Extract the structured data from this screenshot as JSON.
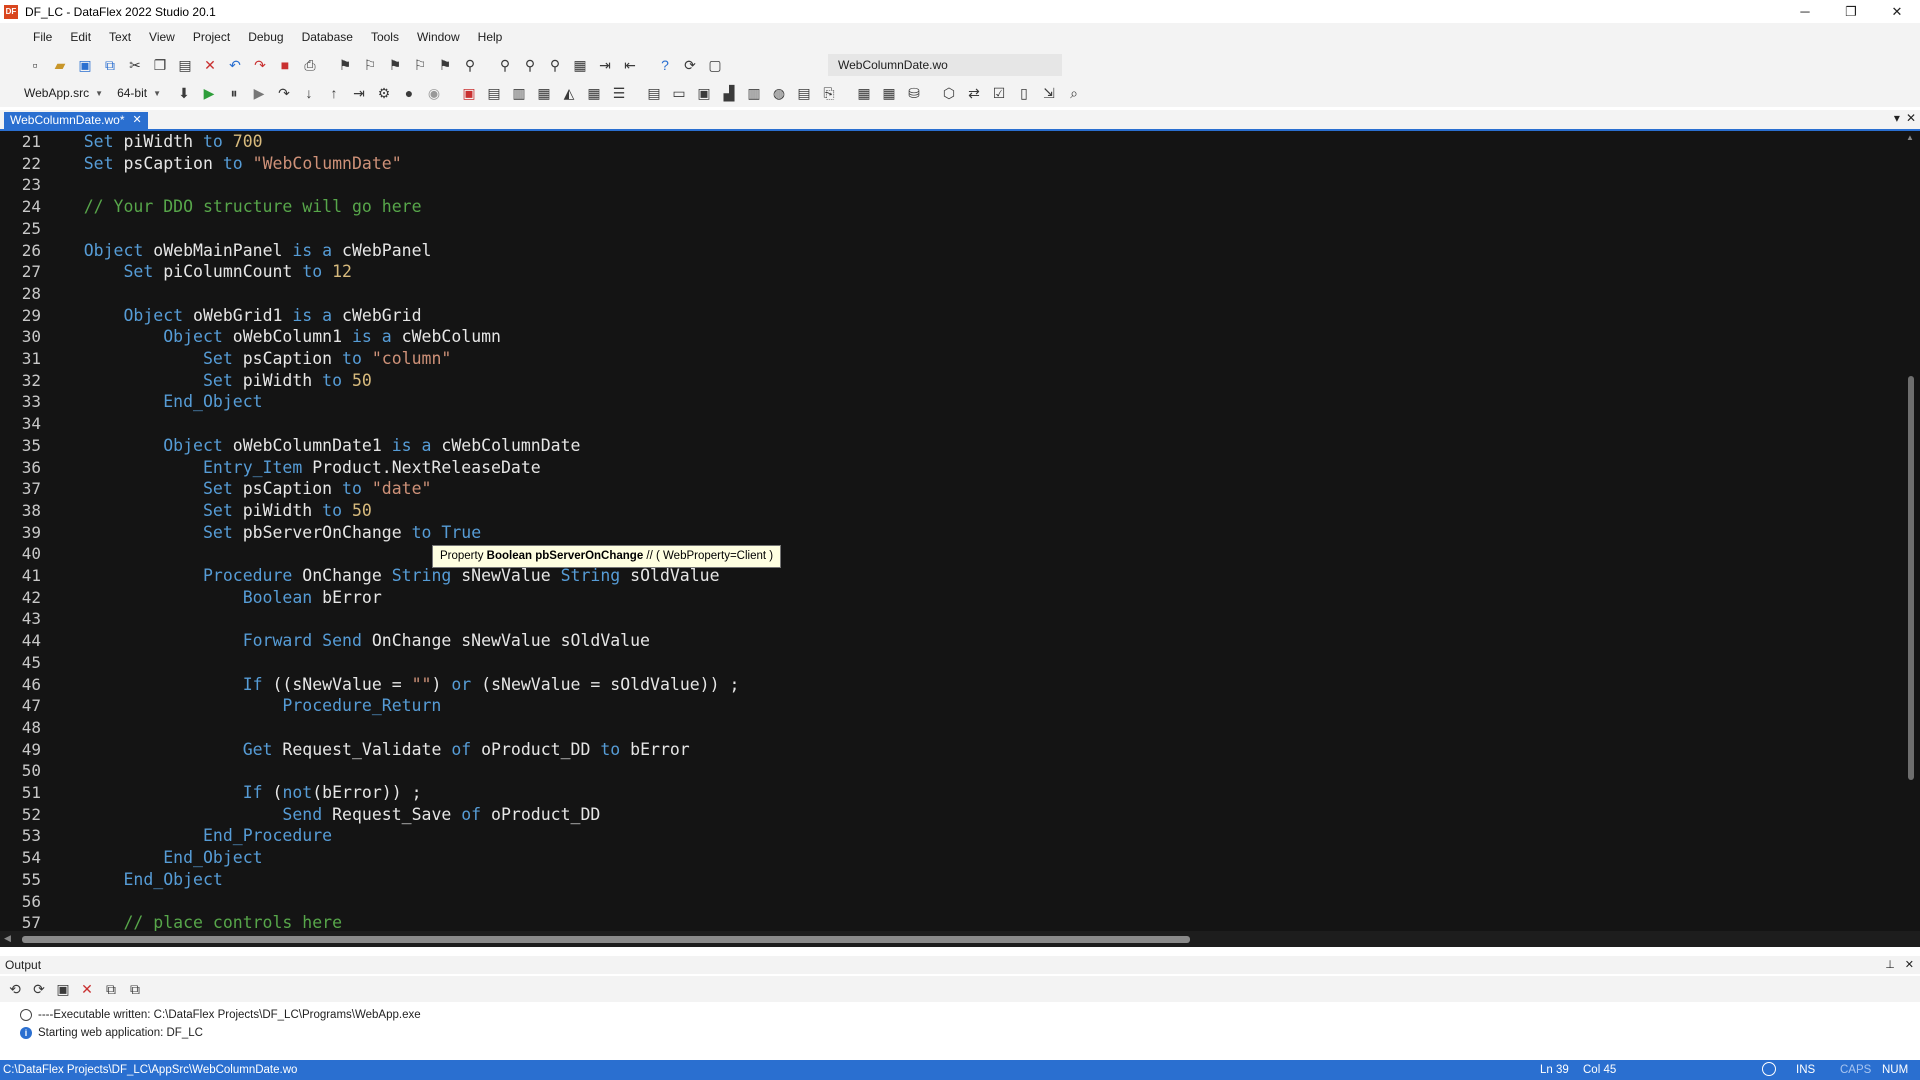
{
  "window": {
    "title": "DF_LC - DataFlex 2022 Studio 20.1",
    "app_icon": "DF",
    "controls": {
      "minimize": "─",
      "maximize": "❐",
      "close": "✕"
    }
  },
  "menu": [
    "File",
    "Edit",
    "Text",
    "View",
    "Project",
    "Debug",
    "Database",
    "Tools",
    "Window",
    "Help"
  ],
  "toolbar": {
    "active_file": "WebColumnDate.wo",
    "project_select": "WebApp.src",
    "platform_select": "64-bit"
  },
  "tabs": {
    "active": "WebColumnDate.wo*",
    "close": "✕",
    "dropdown": "▾",
    "close_all": "✕"
  },
  "editor": {
    "lines": [
      {
        "n": "21",
        "tokens": [
          [
            "    ",
            "id"
          ],
          [
            "Set",
            "kw"
          ],
          [
            " piWidth ",
            "id"
          ],
          [
            "to",
            "kw"
          ],
          [
            " ",
            "id"
          ],
          [
            "700",
            "num"
          ]
        ]
      },
      {
        "n": "22",
        "tokens": [
          [
            "    ",
            "id"
          ],
          [
            "Set",
            "kw"
          ],
          [
            " psCaption ",
            "id"
          ],
          [
            "to",
            "kw"
          ],
          [
            " ",
            "id"
          ],
          [
            "\"WebColumnDate\"",
            "str"
          ]
        ]
      },
      {
        "n": "23",
        "tokens": []
      },
      {
        "n": "24",
        "tokens": [
          [
            "    ",
            "id"
          ],
          [
            "// Your DDO structure will go here",
            "cmt"
          ]
        ]
      },
      {
        "n": "25",
        "tokens": []
      },
      {
        "n": "26",
        "tokens": [
          [
            "    ",
            "id"
          ],
          [
            "Object",
            "kw"
          ],
          [
            " oWebMainPanel ",
            "id"
          ],
          [
            "is a",
            "kw"
          ],
          [
            " cWebPanel",
            "id"
          ]
        ]
      },
      {
        "n": "27",
        "tokens": [
          [
            "        ",
            "id"
          ],
          [
            "Set",
            "kw"
          ],
          [
            " piColumnCount ",
            "id"
          ],
          [
            "to",
            "kw"
          ],
          [
            " ",
            "id"
          ],
          [
            "12",
            "num"
          ]
        ]
      },
      {
        "n": "28",
        "tokens": []
      },
      {
        "n": "29",
        "tokens": [
          [
            "        ",
            "id"
          ],
          [
            "Object",
            "kw"
          ],
          [
            " oWebGrid1 ",
            "id"
          ],
          [
            "is a",
            "kw"
          ],
          [
            " cWebGrid",
            "id"
          ]
        ]
      },
      {
        "n": "30",
        "tokens": [
          [
            "            ",
            "id"
          ],
          [
            "Object",
            "kw"
          ],
          [
            " oWebColumn1 ",
            "id"
          ],
          [
            "is a",
            "kw"
          ],
          [
            " cWebColumn",
            "id"
          ]
        ]
      },
      {
        "n": "31",
        "tokens": [
          [
            "                ",
            "id"
          ],
          [
            "Set",
            "kw"
          ],
          [
            " psCaption ",
            "id"
          ],
          [
            "to",
            "kw"
          ],
          [
            " ",
            "id"
          ],
          [
            "\"column\"",
            "str"
          ]
        ]
      },
      {
        "n": "32",
        "tokens": [
          [
            "                ",
            "id"
          ],
          [
            "Set",
            "kw"
          ],
          [
            " piWidth ",
            "id"
          ],
          [
            "to",
            "kw"
          ],
          [
            " ",
            "id"
          ],
          [
            "50",
            "num"
          ]
        ]
      },
      {
        "n": "33",
        "tokens": [
          [
            "            ",
            "id"
          ],
          [
            "End_Object",
            "kw"
          ]
        ]
      },
      {
        "n": "34",
        "tokens": []
      },
      {
        "n": "35",
        "tokens": [
          [
            "            ",
            "id"
          ],
          [
            "Object",
            "kw"
          ],
          [
            " oWebColumnDate1 ",
            "id"
          ],
          [
            "is a",
            "kw"
          ],
          [
            " cWebColumnDate",
            "id"
          ]
        ]
      },
      {
        "n": "36",
        "tokens": [
          [
            "                ",
            "id"
          ],
          [
            "Entry_Item",
            "kw"
          ],
          [
            " Product.NextReleaseDate",
            "id"
          ]
        ]
      },
      {
        "n": "37",
        "tokens": [
          [
            "                ",
            "id"
          ],
          [
            "Set",
            "kw"
          ],
          [
            " psCaption ",
            "id"
          ],
          [
            "to",
            "kw"
          ],
          [
            " ",
            "id"
          ],
          [
            "\"date\"",
            "str"
          ]
        ]
      },
      {
        "n": "38",
        "tokens": [
          [
            "                ",
            "id"
          ],
          [
            "Set",
            "kw"
          ],
          [
            " piWidth ",
            "id"
          ],
          [
            "to",
            "kw"
          ],
          [
            " ",
            "id"
          ],
          [
            "50",
            "num"
          ]
        ]
      },
      {
        "n": "39",
        "tokens": [
          [
            "                ",
            "id"
          ],
          [
            "Set",
            "kw"
          ],
          [
            " pbServerOnChange ",
            "id"
          ],
          [
            "to",
            "kw"
          ],
          [
            " ",
            "id"
          ],
          [
            "True",
            "kw"
          ]
        ]
      },
      {
        "n": "40",
        "tokens": []
      },
      {
        "n": "41",
        "tokens": [
          [
            "                ",
            "id"
          ],
          [
            "Procedure",
            "kw"
          ],
          [
            " OnChange ",
            "id"
          ],
          [
            "String",
            "kw"
          ],
          [
            " sNewValue ",
            "id"
          ],
          [
            "String",
            "kw"
          ],
          [
            " sOldValue",
            "id"
          ]
        ]
      },
      {
        "n": "42",
        "tokens": [
          [
            "                    ",
            "id"
          ],
          [
            "Boolean",
            "kw"
          ],
          [
            " bError",
            "id"
          ]
        ]
      },
      {
        "n": "43",
        "tokens": []
      },
      {
        "n": "44",
        "tokens": [
          [
            "                    ",
            "id"
          ],
          [
            "Forward Send",
            "kw"
          ],
          [
            " OnChange sNewValue sOldValue",
            "id"
          ]
        ]
      },
      {
        "n": "45",
        "tokens": []
      },
      {
        "n": "46",
        "tokens": [
          [
            "                    ",
            "id"
          ],
          [
            "If",
            "kw"
          ],
          [
            " ((sNewValue = ",
            "id"
          ],
          [
            "\"\"",
            "str"
          ],
          [
            ") ",
            "id"
          ],
          [
            "or",
            "kw"
          ],
          [
            " (sNewValue = sOldValue)) ;",
            "id"
          ]
        ]
      },
      {
        "n": "47",
        "tokens": [
          [
            "                        ",
            "id"
          ],
          [
            "Procedure_Return",
            "kw"
          ]
        ]
      },
      {
        "n": "48",
        "tokens": []
      },
      {
        "n": "49",
        "tokens": [
          [
            "                    ",
            "id"
          ],
          [
            "Get",
            "kw"
          ],
          [
            " Request_Validate ",
            "id"
          ],
          [
            "of",
            "kw"
          ],
          [
            " oProduct_DD ",
            "id"
          ],
          [
            "to",
            "kw"
          ],
          [
            " bError",
            "id"
          ]
        ]
      },
      {
        "n": "50",
        "tokens": []
      },
      {
        "n": "51",
        "tokens": [
          [
            "                    ",
            "id"
          ],
          [
            "If",
            "kw"
          ],
          [
            " (",
            "id"
          ],
          [
            "not",
            "kw"
          ],
          [
            "(bError)) ;",
            "id"
          ]
        ]
      },
      {
        "n": "52",
        "tokens": [
          [
            "                        ",
            "id"
          ],
          [
            "Send",
            "kw"
          ],
          [
            " Request_Save ",
            "id"
          ],
          [
            "of",
            "kw"
          ],
          [
            " oProduct_DD",
            "id"
          ]
        ]
      },
      {
        "n": "53",
        "tokens": [
          [
            "                ",
            "id"
          ],
          [
            "End_Procedure",
            "kw"
          ]
        ]
      },
      {
        "n": "54",
        "tokens": [
          [
            "            ",
            "id"
          ],
          [
            "End_Object",
            "kw"
          ]
        ]
      },
      {
        "n": "55",
        "tokens": [
          [
            "        ",
            "id"
          ],
          [
            "End_Object",
            "kw"
          ]
        ]
      },
      {
        "n": "56",
        "tokens": []
      },
      {
        "n": "57",
        "tokens": [
          [
            "        ",
            "id"
          ],
          [
            "// place controls here",
            "cmt"
          ]
        ]
      }
    ],
    "tooltip": {
      "prefix": "Property ",
      "bold": "Boolean pbServerOnChange",
      "suffix": " // ( WebProperty=Client )"
    }
  },
  "output": {
    "title": "Output",
    "pin": "⊥",
    "close": "✕",
    "lines": [
      {
        "icon": "ok-circle-icon",
        "text": "----Executable written: C:\\DataFlex Projects\\DF_LC\\Programs\\WebApp.exe"
      },
      {
        "icon": "info-icon",
        "text": "Starting web application: DF_LC"
      }
    ]
  },
  "status": {
    "path": "C:\\DataFlex Projects\\DF_LC\\AppSrc\\WebColumnDate.wo",
    "ln": "Ln 39",
    "col": "Col 45",
    "ins": "INS",
    "caps": "CAPS",
    "num": "NUM"
  },
  "colors": {
    "accent": "#2a6fd0",
    "editor_bg": "#141414",
    "keyword": "#569cd6",
    "string": "#ce9178",
    "number": "#d7ba7d",
    "comment": "#57a64a"
  }
}
